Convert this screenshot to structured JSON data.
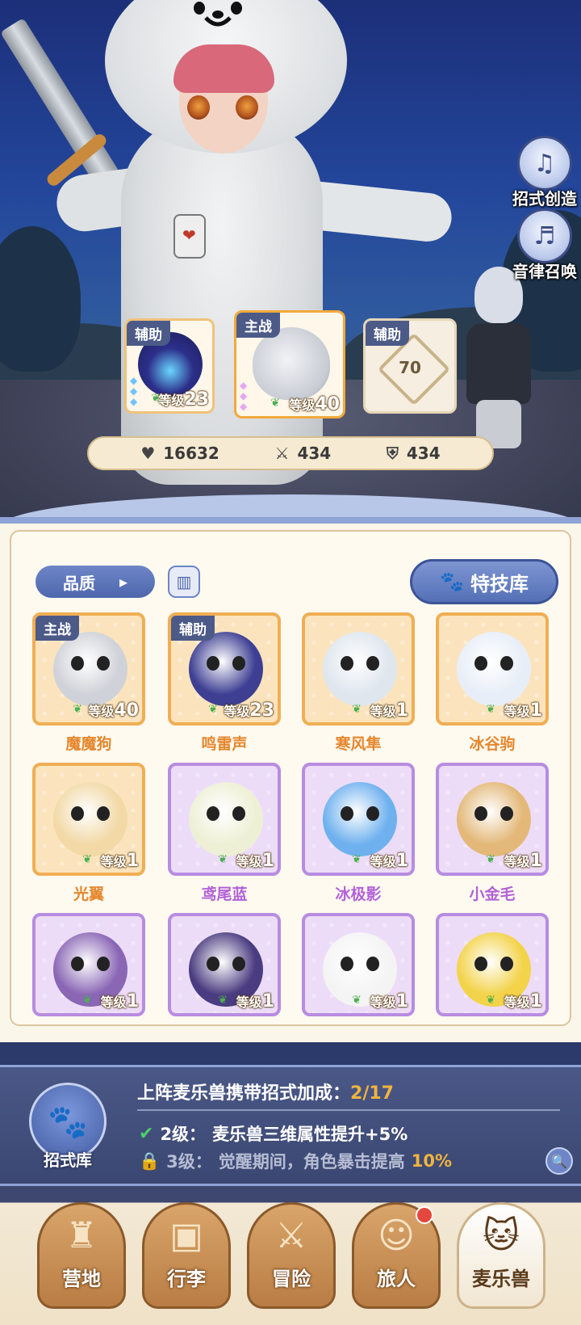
{
  "side_buttons": [
    {
      "label": "招式创造",
      "icon": "book-music-icon"
    },
    {
      "label": "音律召唤",
      "icon": "chat-music-icon"
    }
  ],
  "team": {
    "left": {
      "tag": "辅助",
      "level_label": "等级",
      "level": "23"
    },
    "center": {
      "tag": "主战",
      "level_label": "等级",
      "level": "40"
    },
    "right": {
      "tag": "辅助",
      "unlock_level": "70"
    }
  },
  "stats": {
    "hp": "16632",
    "attack": "434",
    "defense": "434"
  },
  "filters": {
    "quality_label": "品质",
    "skill_library_label": "特技库"
  },
  "pets": [
    {
      "name": "魔魔狗",
      "tag": "主战",
      "level_label": "等级",
      "level": "40",
      "frame": "orange",
      "color": "#cfd2d8"
    },
    {
      "name": "鸣雷声",
      "tag": "辅助",
      "level_label": "等级",
      "level": "23",
      "frame": "orange",
      "color": "#3e3f93"
    },
    {
      "name": "寒风隼",
      "tag": "",
      "level_label": "等级",
      "level": "1",
      "frame": "orange",
      "color": "#dfe6ee"
    },
    {
      "name": "冰谷驹",
      "tag": "",
      "level_label": "等级",
      "level": "1",
      "frame": "orange",
      "color": "#e8eef8"
    },
    {
      "name": "光翼",
      "tag": "",
      "level_label": "等级",
      "level": "1",
      "frame": "orange",
      "color": "#f2d9a6"
    },
    {
      "name": "鸢尾蓝",
      "tag": "",
      "level_label": "等级",
      "level": "1",
      "frame": "purple",
      "color": "#eef0d6"
    },
    {
      "name": "冰极影",
      "tag": "",
      "level_label": "等级",
      "level": "1",
      "frame": "purple",
      "color": "#6fb1ef"
    },
    {
      "name": "小金毛",
      "tag": "",
      "level_label": "等级",
      "level": "1",
      "frame": "purple",
      "color": "#e3b878"
    },
    {
      "name": "",
      "tag": "",
      "level_label": "等级",
      "level": "1",
      "frame": "purple",
      "color": "#8a66b5"
    },
    {
      "name": "",
      "tag": "",
      "level_label": "等级",
      "level": "1",
      "frame": "purple",
      "color": "#4a3c80"
    },
    {
      "name": "",
      "tag": "",
      "level_label": "等级",
      "level": "1",
      "frame": "purple",
      "color": "#f4f4f4"
    },
    {
      "name": "",
      "tag": "",
      "level_label": "等级",
      "level": "1",
      "frame": "purple",
      "color": "#f3d34a"
    }
  ],
  "bonus": {
    "icon_label": "招式库",
    "title": "上阵麦乐兽携带招式加成：",
    "progress": "2/17",
    "row1_level": "2级：",
    "row1_text": "麦乐兽三维属性提升+5%",
    "row2_level": "3级：",
    "row2_text": "觉醒期间，角色暴击提高",
    "row2_value": "10%"
  },
  "nav": [
    {
      "label": "营地",
      "icon": "castle-icon",
      "active": false
    },
    {
      "label": "行李",
      "icon": "backpack-icon",
      "active": false
    },
    {
      "label": "冒险",
      "icon": "crossed-swords-icon",
      "active": false
    },
    {
      "label": "旅人",
      "icon": "traveler-icon",
      "active": false,
      "badge": true
    },
    {
      "label": "麦乐兽",
      "icon": "pet-head-icon",
      "active": true
    }
  ],
  "colors": {
    "accent_blue": "#5470b6",
    "orange_frame": "#f0ae54",
    "purple_frame": "#b88ce0",
    "highlight": "#f0b33e"
  }
}
